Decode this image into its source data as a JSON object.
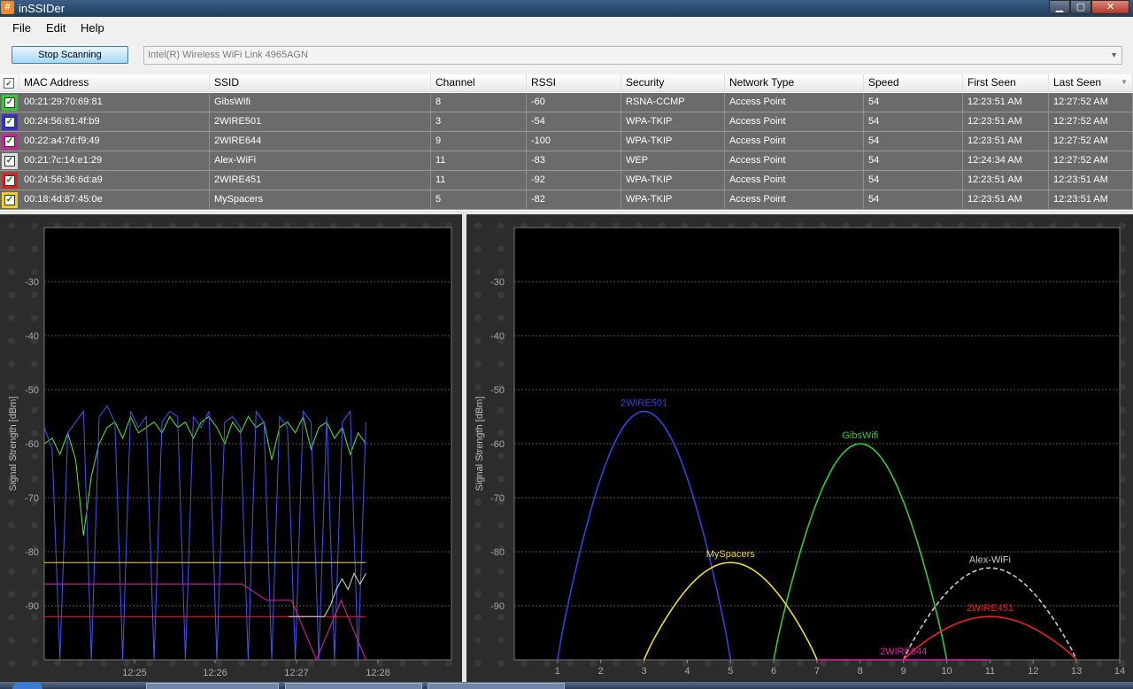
{
  "window": {
    "app_icon": "#",
    "title": "inSSIDer"
  },
  "menu": [
    "File",
    "Edit",
    "Help"
  ],
  "toolbar": {
    "stop_label": "Stop Scanning",
    "adapter_value": "Intel(R) Wireless WiFi Link 4965AGN"
  },
  "table": {
    "columns": [
      "MAC Address",
      "SSID",
      "Channel",
      "RSSI",
      "Security",
      "Network Type",
      "Speed",
      "First Seen",
      "Last Seen"
    ],
    "rows": [
      {
        "color": "#33cc33",
        "mac": "00:21:29:70:69:81",
        "ssid": "GibsWifi",
        "channel": "8",
        "rssi": "-60",
        "security": "RSNA-CCMP",
        "type": "Access Point",
        "speed": "54",
        "first": "12:23:51 AM",
        "last": "12:27:52 AM"
      },
      {
        "color": "#3333cc",
        "mac": "00:24:56:61:4f:b9",
        "ssid": "2WIRE501",
        "channel": "3",
        "rssi": "-54",
        "security": "WPA-TKIP",
        "type": "Access Point",
        "speed": "54",
        "first": "12:23:51 AM",
        "last": "12:27:52 AM"
      },
      {
        "color": "#cc2299",
        "mac": "00:22:a4:7d:f9:49",
        "ssid": "2WIRE644",
        "channel": "9",
        "rssi": "-100",
        "security": "WPA-TKIP",
        "type": "Access Point",
        "speed": "54",
        "first": "12:23:51 AM",
        "last": "12:27:52 AM"
      },
      {
        "color": "#dddddd",
        "mac": "00:21:7c:14:e1:29",
        "ssid": "Alex-WiFi",
        "channel": "11",
        "rssi": "-83",
        "security": "WEP",
        "type": "Access Point",
        "speed": "54",
        "first": "12:24:34 AM",
        "last": "12:27:52 AM"
      },
      {
        "color": "#dd2222",
        "mac": "00:24:56:36:6d:a9",
        "ssid": "2WIRE451",
        "channel": "11",
        "rssi": "-92",
        "security": "WPA-TKIP",
        "type": "Access Point",
        "speed": "54",
        "first": "12:23:51 AM",
        "last": "12:23:51 AM"
      },
      {
        "color": "#eecc22",
        "mac": "00:18:4d:87:45:0e",
        "ssid": "MySpacers",
        "channel": "5",
        "rssi": "-82",
        "security": "WPA-TKIP",
        "type": "Access Point",
        "speed": "54",
        "first": "12:23:51 AM",
        "last": "12:23:51 AM"
      }
    ]
  },
  "chart_data": [
    {
      "type": "line",
      "ylabel": "Signal Strength [dBm]",
      "ylim": [
        -100,
        -20
      ],
      "yticks": [
        "-30",
        "-40",
        "-50",
        "-60",
        "-70",
        "-80",
        "-90"
      ],
      "xticks": [
        "12:25",
        "12:26",
        "12:27",
        "12:28"
      ],
      "grid": true,
      "series": [
        {
          "name": "GibsWifi",
          "color": "#55ee33",
          "values": [
            -60,
            -59,
            -62,
            -58,
            -63,
            -77,
            -66,
            -60,
            -57,
            -56,
            -59,
            -55,
            -58,
            -57,
            -56,
            -58,
            -55,
            -57,
            -56,
            -59,
            -56,
            -55,
            -57,
            -60,
            -56,
            -58,
            -55,
            -57,
            -56,
            -63,
            -57,
            -56,
            -58,
            -55,
            -61,
            -57,
            -56,
            -59,
            -57,
            -62,
            -58,
            -60
          ]
        },
        {
          "name": "2WIRE501",
          "color": "#4455ee",
          "values": [
            -57,
            -61,
            -100,
            -58,
            -56,
            -54,
            -100,
            -55,
            -53,
            -56,
            -100,
            -54,
            -57,
            -55,
            -100,
            -56,
            -54,
            -55,
            -100,
            -55,
            -57,
            -54,
            -100,
            -56,
            -55,
            -57,
            -100,
            -54,
            -56,
            -100,
            -55,
            -57,
            -100,
            -54,
            -56,
            -100,
            -55,
            -100,
            -56,
            -54,
            -100,
            -56
          ]
        },
        {
          "name": "MySpacers",
          "color": "#eedd55",
          "values": [
            -82,
            -82,
            -82,
            -82,
            -82,
            -82,
            -82,
            -82,
            -82,
            -82
          ]
        },
        {
          "name": "2WIRE644",
          "color": "#dd22aa",
          "values": [
            -86,
            -86,
            -86,
            -86,
            -86,
            -86,
            -86,
            -86,
            -86,
            -89,
            -89,
            -100,
            -89,
            -100
          ]
        },
        {
          "name": "2WIRE451",
          "color": "#ee2233",
          "values": [
            -92,
            -92,
            -92,
            -92,
            -92,
            -92,
            -92,
            -92,
            -92,
            -92
          ]
        },
        {
          "name": "Alex-WiFi",
          "color": "#dddddd",
          "values": [
            -92,
            -92,
            -92,
            -92,
            -92,
            -92,
            -92,
            -90,
            -87,
            -85,
            -87,
            -84,
            -86,
            -84
          ]
        }
      ]
    },
    {
      "type": "area",
      "ylabel": "Signal Strength [dBm]",
      "ylim": [
        -100,
        -20
      ],
      "xlim": [
        0,
        14
      ],
      "yticks": [
        "-30",
        "-40",
        "-50",
        "-60",
        "-70",
        "-80",
        "-90"
      ],
      "xticks": [
        "1",
        "2",
        "3",
        "4",
        "5",
        "6",
        "7",
        "8",
        "9",
        "10",
        "11",
        "12",
        "13",
        "14"
      ],
      "grid": true,
      "series": [
        {
          "name": "2WIRE501",
          "channel": 3,
          "rssi": -54,
          "color": "#3344dd"
        },
        {
          "name": "GibsWifi",
          "channel": 8,
          "rssi": -60,
          "color": "#33cc33"
        },
        {
          "name": "MySpacers",
          "channel": 5,
          "rssi": -82,
          "color": "#eedd33"
        },
        {
          "name": "Alex-WiFi",
          "channel": 11,
          "rssi": -83,
          "color": "#cccccc",
          "dashed": true
        },
        {
          "name": "2WIRE451",
          "channel": 11,
          "rssi": -92,
          "color": "#ee2222"
        },
        {
          "name": "2WIRE644",
          "channel": 9,
          "rssi": -100,
          "color": "#dd22aa"
        }
      ]
    }
  ]
}
